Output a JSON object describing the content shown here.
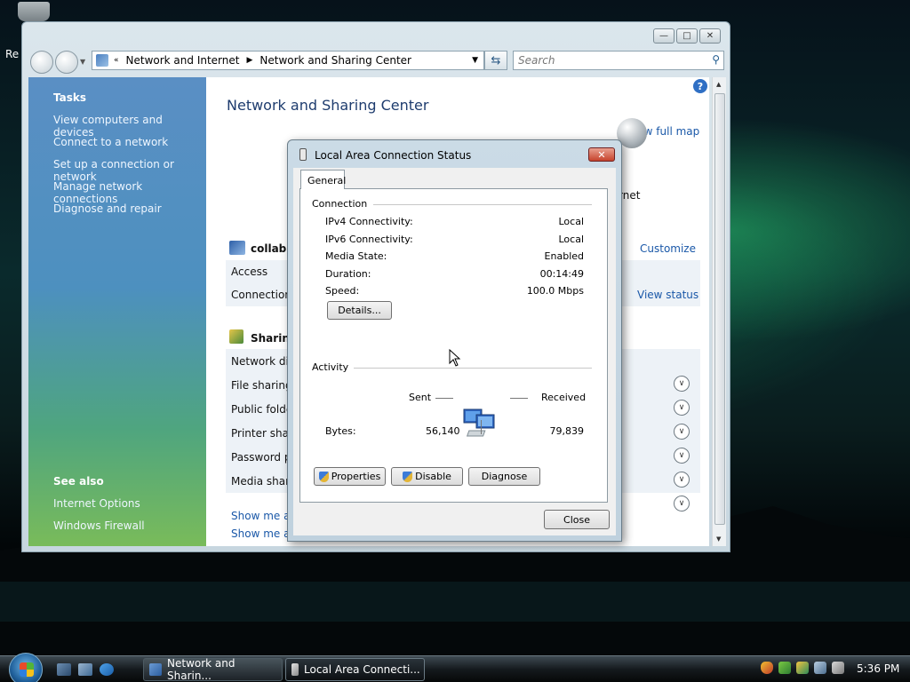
{
  "desktop": {
    "recycle_label": "Re"
  },
  "main_window": {
    "address": {
      "breadcrumb": [
        "Network and Internet",
        "Network and Sharing Center"
      ]
    },
    "search": {
      "placeholder": "Search"
    },
    "sidebar": {
      "tasks_heading": "Tasks",
      "tasks": [
        "View computers and devices",
        "Connect to a network",
        "Set up a connection or network",
        "Manage network connections",
        "Diagnose and repair"
      ],
      "see_also_heading": "See also",
      "see_also": [
        "Internet Options",
        "Windows Firewall"
      ]
    },
    "content": {
      "title": "Network and Sharing Center",
      "view_full_map": "View full map",
      "internet_label": "rnet",
      "network_name": "collabne",
      "customize": "Customize",
      "access_label": "Access",
      "connection_label": "Connection",
      "view_status": "View status",
      "sharing_heading": "Sharing",
      "sharing_rows": [
        "Network dis",
        "File sharing",
        "Public folde",
        "Printer shari",
        "Password pr",
        "Media sharir"
      ],
      "show_me_links": [
        "Show me all",
        "Show me all"
      ]
    }
  },
  "dialog": {
    "title": "Local Area Connection Status",
    "tab": "General",
    "connection_group": "Connection",
    "rows": [
      {
        "label": "IPv4 Connectivity:",
        "value": "Local"
      },
      {
        "label": "IPv6 Connectivity:",
        "value": "Local"
      },
      {
        "label": "Media State:",
        "value": "Enabled"
      },
      {
        "label": "Duration:",
        "value": "00:14:49"
      },
      {
        "label": "Speed:",
        "value": "100.0 Mbps"
      }
    ],
    "details_button": "Details...",
    "activity_group": "Activity",
    "sent_label": "Sent",
    "received_label": "Received",
    "bytes_label": "Bytes:",
    "bytes_sent": "56,140",
    "bytes_received": "79,839",
    "properties_button": "Properties",
    "disable_button": "Disable",
    "diagnose_button": "Diagnose",
    "close_button": "Close"
  },
  "taskbar": {
    "tasks": [
      "Network and Sharin...",
      "Local Area Connecti..."
    ],
    "clock": "5:36 PM"
  }
}
